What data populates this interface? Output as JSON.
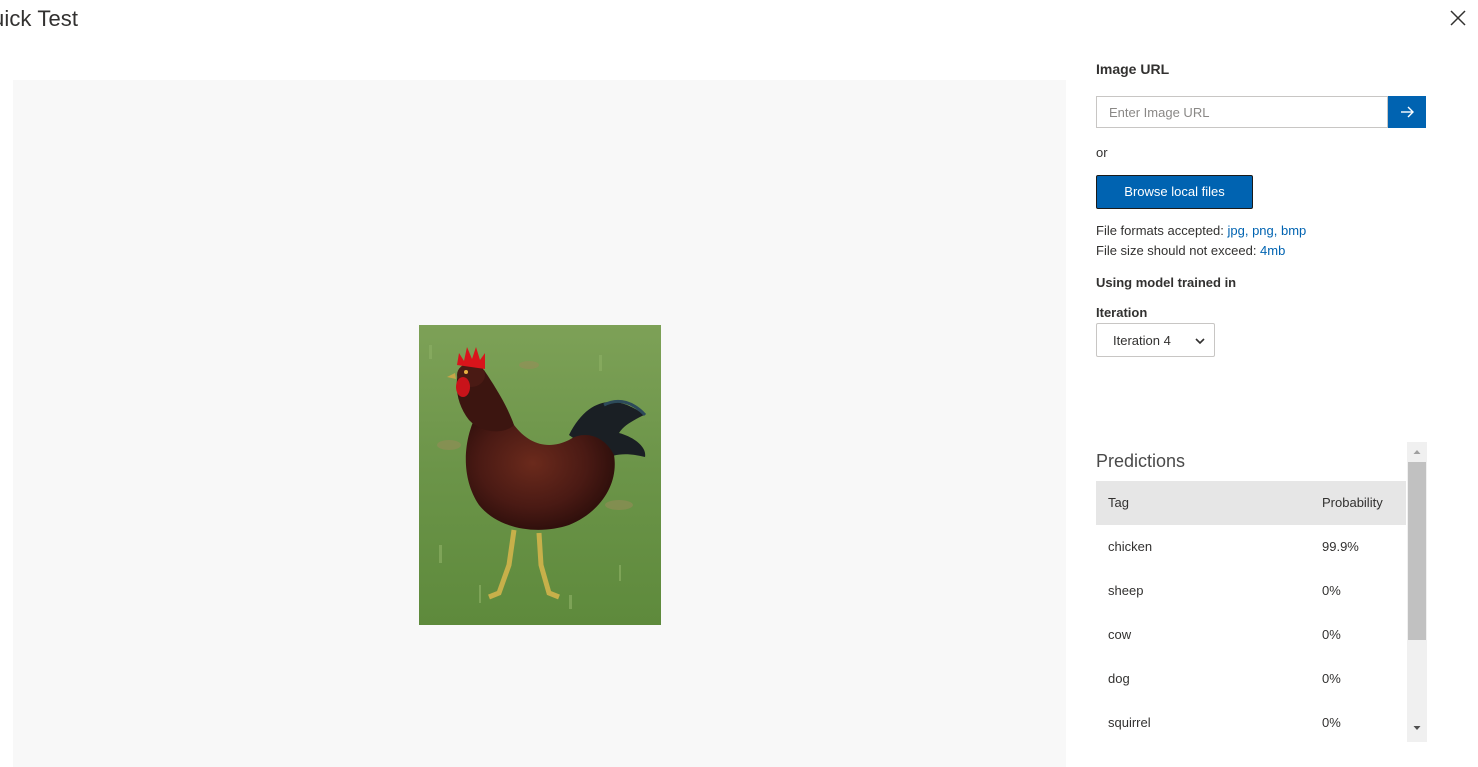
{
  "dialog": {
    "title": "uick Test",
    "close_icon": "close-icon"
  },
  "image_url": {
    "label": "Image URL",
    "placeholder": "Enter Image URL",
    "value": "",
    "submit_icon": "arrow-right-icon"
  },
  "or_text": "or",
  "browse_button": "Browse local files",
  "file_formats": {
    "prefix": "File formats accepted: ",
    "formats": "jpg, png, bmp"
  },
  "file_size": {
    "prefix": "File size should not exceed: ",
    "limit": "4mb"
  },
  "model_label": "Using model trained in",
  "iteration": {
    "label": "Iteration",
    "selected": "Iteration 4"
  },
  "predictions": {
    "title": "Predictions",
    "columns": [
      "Tag",
      "Probability"
    ],
    "rows": [
      {
        "tag": "chicken",
        "probability": "99.9%"
      },
      {
        "tag": "sheep",
        "probability": "0%"
      },
      {
        "tag": "cow",
        "probability": "0%"
      },
      {
        "tag": "dog",
        "probability": "0%"
      },
      {
        "tag": "squirrel",
        "probability": "0%"
      }
    ]
  },
  "colors": {
    "accent": "#0063b1",
    "preview_bg": "#f8f8f8",
    "table_header_bg": "#e6e6e6"
  }
}
